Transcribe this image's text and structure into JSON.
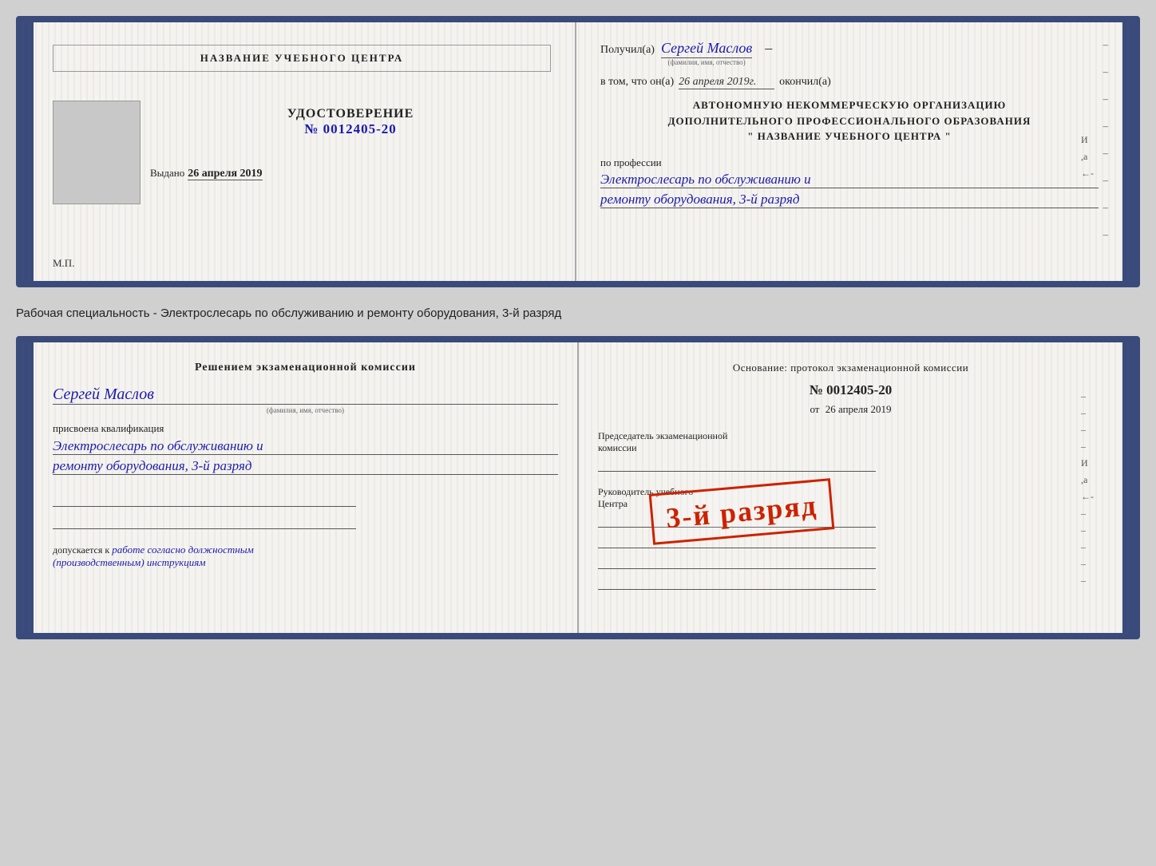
{
  "topDoc": {
    "left": {
      "title": "НАЗВАНИЕ УЧЕБНОГО ЦЕНТРА",
      "photoAlt": "photo placeholder",
      "udostoverenie": "УДОСТОВЕРЕНИЕ",
      "number": "№ 0012405-20",
      "vydanoLabel": "Выдано",
      "vydanoDate": "26 апреля 2019",
      "mpLabel": "М.П."
    },
    "right": {
      "poluchilLabel": "Получил(а)",
      "recipientName": "Сергей Маслов",
      "fioSub": "(фамилия, имя, отчество)",
      "vtomLabel": "в том, что он(а)",
      "vtomDate": "26 апреля 2019г.",
      "okonchilLabel": "окончил(а)",
      "orgBlock": "АВТОНОМНУЮ НЕКОММЕРЧЕСКУЮ ОРГАНИЗАЦИЮ\nДОПОЛНИТЕЛЬНОГО ПРОФЕССИОНАЛЬНОГО ОБРАЗОВАНИЯ\n\"   НАЗВАНИЕ УЧЕБНОГО ЦЕНТРА   \"",
      "poProfessiiLabel": "по профессии",
      "profLine1": "Электрослесарь по обслуживанию и",
      "profLine2": "ремонту оборудования, 3-й разряд"
    }
  },
  "subtitle": "Рабочая специальность - Электрослесарь по обслуживанию и ремонту оборудования, 3-й разряд",
  "bottomDoc": {
    "left": {
      "resheniyemTitle": "Решением экзаменационной  комиссии",
      "name": "Сергей Маслов",
      "fioSub": "(фамилия, имя, отчество)",
      "prisvoyenaLabel": "присвоена квалификация",
      "profLine1": "Электрослесарь по обслуживанию и",
      "profLine2": "ремонту оборудования, 3-й разряд",
      "dopuskaetsyaLabel": "допускается к",
      "dopuskaetsyaValue": "работе согласно должностным\n(производственным) инструкциям"
    },
    "right": {
      "osnovanieLabelFull": "Основание: протокол экзаменационной  комиссии",
      "osnovanieNumber": "№  0012405-20",
      "otLabel": "от",
      "otDate": "26 апреля 2019",
      "predsedatelLabel": "Председатель экзаменационной\nкомиссии",
      "rukovoditelLabel": "Руководитель учебного\nЦентра"
    },
    "stamp": "3-й разряд"
  }
}
